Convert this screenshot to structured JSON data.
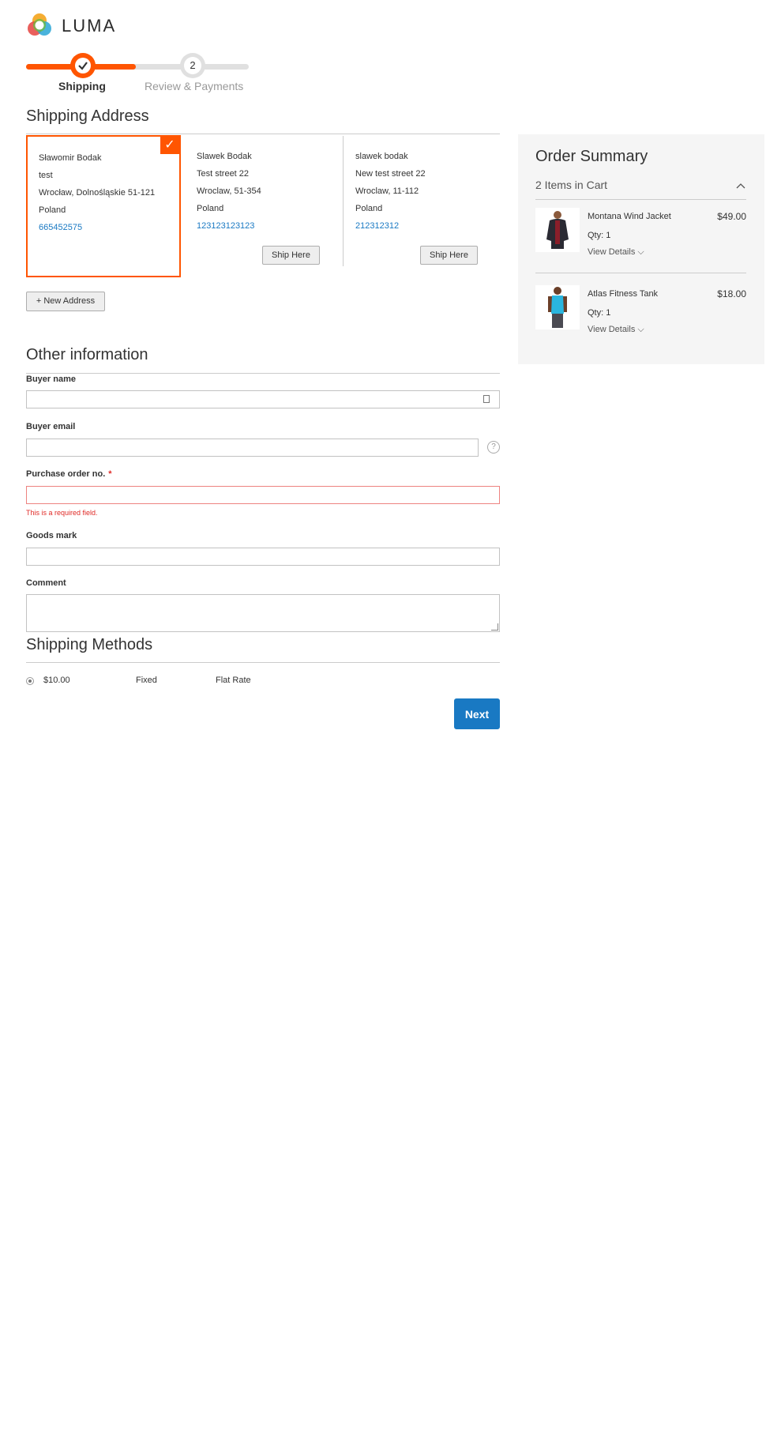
{
  "header": {
    "logo_text": "LUMA",
    "logo_icon": "luma-logo-icon"
  },
  "progress": {
    "steps": [
      {
        "label": "Shipping",
        "marker": "check-icon"
      },
      {
        "label": "Review & Payments",
        "marker": "2"
      }
    ],
    "active_step": 1
  },
  "shipping_address": {
    "title": "Shipping Address",
    "addresses": [
      {
        "name": "Sławomir Bodak",
        "street": "test",
        "city_line": "Wrocław, Dolnośląskie 51-121",
        "country": "Poland",
        "phone": "665452575",
        "selected": true
      },
      {
        "name": "Slawek Bodak",
        "street": "Test street 22",
        "city_line": "Wroclaw, 51-354",
        "country": "Poland",
        "phone": "123123123123",
        "selected": false,
        "button": "Ship Here"
      },
      {
        "name": "slawek bodak",
        "street": "New test street 22",
        "city_line": "Wroclaw, 11-112",
        "country": "Poland",
        "phone": "212312312",
        "selected": false,
        "button": "Ship Here"
      }
    ],
    "new_address_button": "+ New Address"
  },
  "other_info": {
    "title": "Other information",
    "fields": {
      "buyer_name": {
        "label": "Buyer name",
        "value": ""
      },
      "buyer_email": {
        "label": "Buyer email",
        "value": ""
      },
      "purchase_order": {
        "label": "Purchase order no.",
        "required_mark": "*",
        "value": "",
        "error": "This is a required field."
      },
      "goods_mark": {
        "label": "Goods mark",
        "value": ""
      },
      "comment": {
        "label": "Comment",
        "value": ""
      }
    }
  },
  "shipping_methods": {
    "title": "Shipping Methods",
    "options": [
      {
        "price": "$10.00",
        "method": "Fixed",
        "carrier": "Flat Rate",
        "selected": true
      }
    ],
    "next_button": "Next"
  },
  "order_summary": {
    "title": "Order Summary",
    "items_count": "2 Items in Cart",
    "items": [
      {
        "name": "Montana Wind Jacket",
        "qty": "Qty: 1",
        "details": "View Details",
        "price": "$49.00"
      },
      {
        "name": "Atlas Fitness Tank",
        "qty": "Qty: 1",
        "details": "View Details",
        "price": "$18.00"
      }
    ]
  },
  "colors": {
    "accent": "#ff5501",
    "primary_button": "#1979c3",
    "error": "#e02b27"
  }
}
